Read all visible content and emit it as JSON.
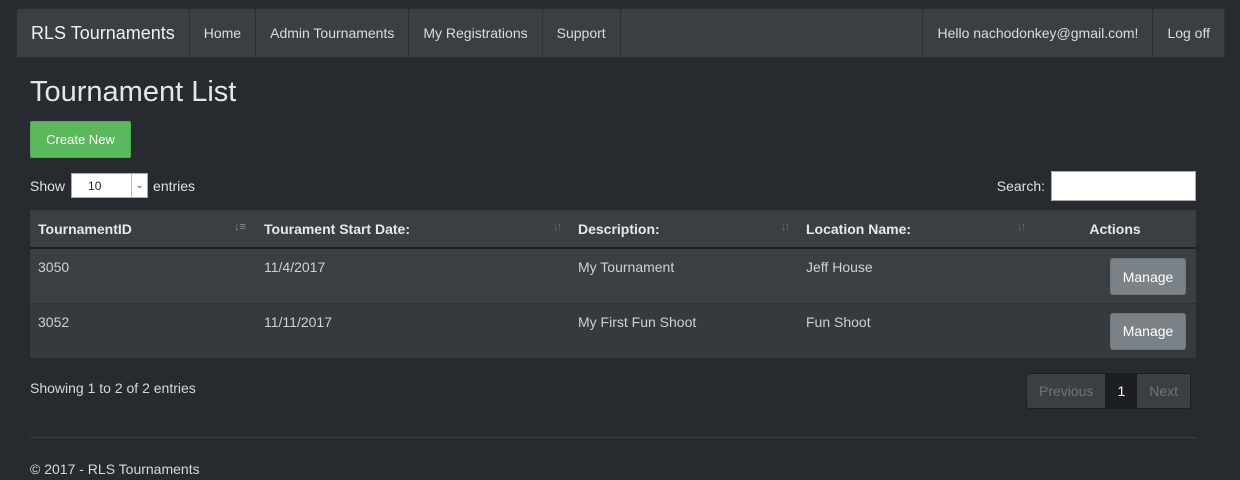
{
  "navbar": {
    "brand": "RLS Tournaments",
    "items": [
      "Home",
      "Admin Tournaments",
      "My Registrations",
      "Support"
    ],
    "greeting": "Hello nachodonkey@gmail.com!",
    "logoff": "Log off"
  },
  "page": {
    "title": "Tournament List",
    "create_label": "Create New"
  },
  "length": {
    "show_label": "Show",
    "value": "10",
    "entries_label": "entries"
  },
  "search": {
    "label": "Search:",
    "value": ""
  },
  "table": {
    "headers": [
      "TournamentID",
      "Tourament Start Date:",
      "Description:",
      "Location Name:",
      "Actions"
    ],
    "rows": [
      {
        "id": "3050",
        "date": "11/4/2017",
        "description": "My Tournament",
        "location": "Jeff House",
        "action": "Manage"
      },
      {
        "id": "3052",
        "date": "11/11/2017",
        "description": "My First Fun Shoot",
        "location": "Fun Shoot",
        "action": "Manage"
      }
    ]
  },
  "info": "Showing 1 to 2 of 2 entries",
  "pagination": {
    "previous": "Previous",
    "current": "1",
    "next": "Next"
  },
  "footer": "© 2017 - RLS Tournaments"
}
